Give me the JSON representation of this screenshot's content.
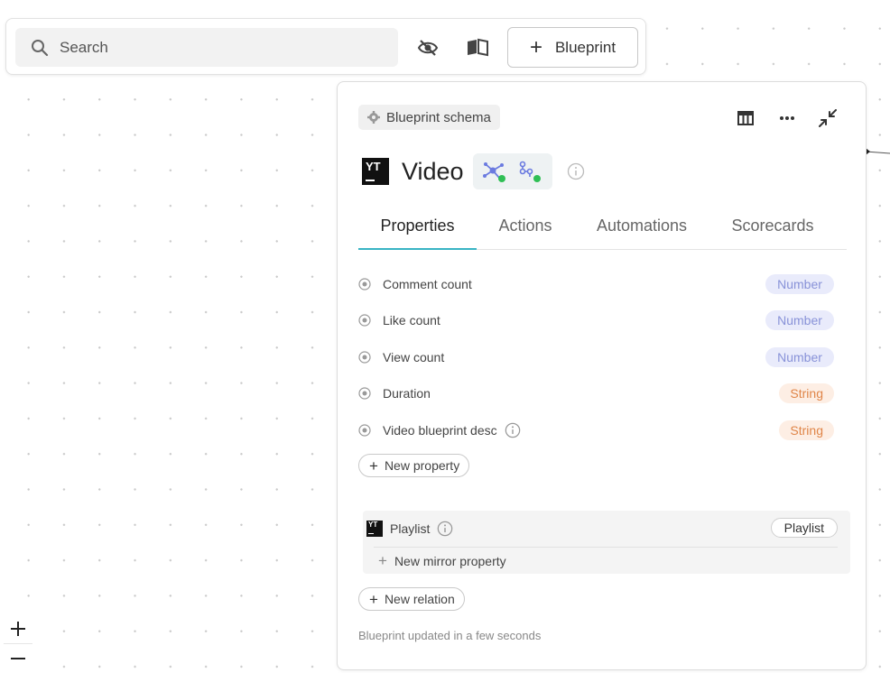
{
  "toolbar": {
    "search_placeholder": "Search",
    "blueprint_button": "Blueprint"
  },
  "panel": {
    "chip_label": "Blueprint schema",
    "title": "Video",
    "tabs": [
      "Properties",
      "Actions",
      "Automations",
      "Scorecards"
    ],
    "active_tab": "Properties",
    "properties": [
      {
        "name": "Comment count",
        "type": "Number",
        "has_info": false
      },
      {
        "name": "Like count",
        "type": "Number",
        "has_info": false
      },
      {
        "name": "View count",
        "type": "Number",
        "has_info": false
      },
      {
        "name": "Duration",
        "type": "String",
        "has_info": false
      },
      {
        "name": "Video blueprint desc",
        "type": "String",
        "has_info": true
      }
    ],
    "new_property_label": "New property",
    "relation": {
      "name": "Playlist",
      "target": "Playlist"
    },
    "new_mirror_label": "New mirror property",
    "new_relation_label": "New relation",
    "footer": "Blueprint updated in a few seconds"
  },
  "colors": {
    "active_tab_underline": "#38b4c4",
    "number_badge_bg": "#e9ebfb",
    "number_badge_text": "#8892d8",
    "string_badge_bg": "#fdeee4",
    "string_badge_text": "#e08548"
  },
  "icons": [
    "search-icon",
    "eye-off-icon",
    "book-open-icon",
    "table-icon",
    "more-icon",
    "collapse-icon",
    "gear-icon",
    "info-icon",
    "target-icon",
    "plus-icon",
    "zoom-in-icon",
    "zoom-out-icon"
  ]
}
